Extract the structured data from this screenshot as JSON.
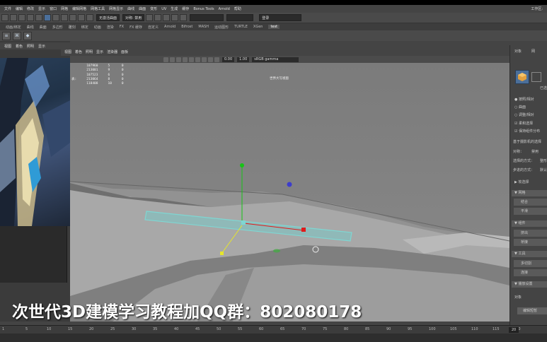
{
  "menubar": {
    "items": [
      "文件",
      "编辑",
      "修改",
      "显示",
      "窗口",
      "网格",
      "编辑网格",
      "网格工具",
      "网格显示",
      "曲线",
      "曲面",
      "变形",
      "UV",
      "生成",
      "缓存",
      "Bonus Tools",
      "Arnold",
      "帮助"
    ],
    "workspace": "工作区:"
  },
  "statusline": {
    "mode_field": "无激活曲面",
    "symmetry": "对称: 禁用",
    "login": "登录"
  },
  "shelf": {
    "tabs": [
      "动画/绑定",
      "曲线",
      "曲面",
      "多边形",
      "雕刻",
      "绑定",
      "动画",
      "渲染",
      "FX",
      "FX 缓存",
      "自定义",
      "Arnold",
      "Bifrost",
      "MASH",
      "运动图形",
      "TURTLE",
      "XGen",
      "test"
    ]
  },
  "viewport": {
    "menu": [
      "视图",
      "着色",
      "照明",
      "显示",
      "渲染器",
      "面板"
    ],
    "exposure": "0.00",
    "gamma": "1.00",
    "colorspace": "sRGB gamma",
    "center_label": "世界大写视窗",
    "hud_rows": [
      [
        "",
        "107960",
        "5",
        "0"
      ],
      [
        "",
        "213001",
        "9",
        "0"
      ],
      [
        "",
        "107523",
        "6",
        "0"
      ],
      [
        "表:",
        "213064",
        "8",
        "0"
      ],
      [
        "",
        "118408",
        "10",
        "0"
      ]
    ]
  },
  "left_panel": {
    "menu": [
      "视图",
      "着色",
      "照明",
      "显示",
      "渲染器"
    ]
  },
  "right_panel": {
    "tab_label": "对象",
    "tab2": "网",
    "already": "已选",
    "options": [
      "按照/相对",
      "曲面",
      "调整/相对",
      "柔和选择",
      "保持组件分布"
    ],
    "based_on": "基于摄影机的选择",
    "symmetry": "对称：",
    "symmetry_val": "禁用",
    "sel_mode": "选择的方式：",
    "sel_mode_val": "整形",
    "step": "步进的方式：",
    "step_val": "默认",
    "soft_select": "软选择",
    "sections": [
      "网格",
      "组件",
      "工具",
      "播放设置"
    ],
    "buttons": [
      "结合",
      "平滑",
      "挤出",
      "桥接",
      "多切割",
      "连接"
    ],
    "object": "对象",
    "bottom_button": "编辑短暂"
  },
  "timeline": {
    "ticks": [
      "5",
      "10",
      "15",
      "20",
      "25",
      "30",
      "35",
      "40",
      "45",
      "50",
      "55",
      "60",
      "65",
      "70",
      "75",
      "80",
      "85",
      "90",
      "95",
      "100",
      "105",
      "110",
      "115",
      "120"
    ],
    "start": "1",
    "frame": "20"
  },
  "watermark": {
    "text": "次世代3D建模学习教程加QQ群：802080178"
  },
  "colors": {
    "accent": "#4b6f9a",
    "gizmo_x": "#e01b1b",
    "gizmo_y": "#16c416",
    "gizmo_z": "#3d3dcc",
    "selection": "#7fd6d2"
  }
}
